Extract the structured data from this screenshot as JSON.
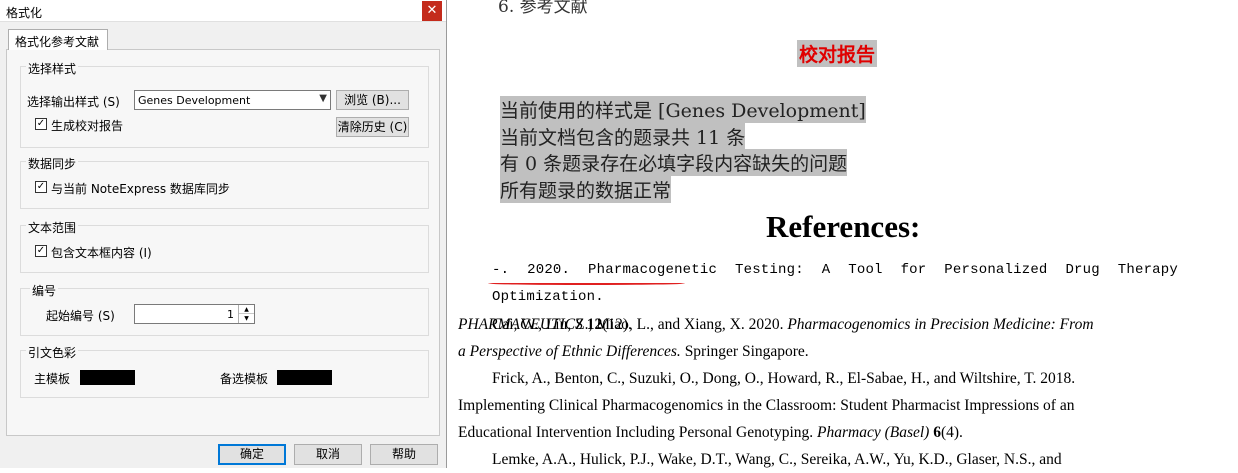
{
  "dialog": {
    "title": "格式化",
    "close_glyph": "✕",
    "tab_label": "格式化参考文献",
    "style_group": {
      "title": "选择样式",
      "output_style_label": "选择输出样式 (S)",
      "output_style_value": "Genes Development",
      "browse_button": "浏览 (B)...",
      "gen_report_label": "生成校对报告",
      "gen_report_checked": true,
      "clear_history_button": "清除历史 (C)"
    },
    "sync_group": {
      "title": "数据同步",
      "sync_label": "与当前 NoteExpress 数据库同步",
      "sync_checked": true
    },
    "text_range_group": {
      "title": "文本范围",
      "include_textbox_label": "包含文本框内容 (I)",
      "include_textbox_checked": true
    },
    "numbering_group": {
      "title": "编号",
      "start_number_label": "起始编号 (S)",
      "start_number_value": "1"
    },
    "color_group": {
      "title": "引文色彩",
      "main_template_label": "主模板",
      "alt_template_label": "备选模板",
      "main_template_color": "#000000",
      "alt_template_color": "#000000"
    },
    "buttons": {
      "ok": "确定",
      "cancel": "取消",
      "help": "帮助"
    }
  },
  "document": {
    "previous_heading": "6. 参考文献",
    "report_title": "校对报告",
    "report_lines": [
      "当前使用的样式是  [Genes Development]",
      "当前文档包含的题录共 11 条",
      "有 0 条题录存在必填字段内容缺失的问题",
      "所有题录的数据正常"
    ],
    "references_heading": "References:",
    "references": {
      "r1": {
        "l1": "-. 2020. Pharmacogenetic Testing: A Tool for Personalized Drug Therapy Optimization.",
        "l2_italic": "PHARMACEUTICS",
        "l2_bold": " 12",
        "l2_rest": "(12)."
      },
      "r2": {
        "l1_plain": "Cai, W., Liu, Z., Miao, L., and Xiang, X. 2020. ",
        "l1_italic": "Pharmacogenomics in Precision Medicine: From",
        "l2_italic": "a Perspective of Ethnic Differences.",
        "l2_rest": " Springer Singapore."
      },
      "r3": {
        "l1": "Frick, A., Benton, C., Suzuki, O., Dong, O., Howard, R., El-Sabae, H., and Wiltshire, T. 2018.",
        "l2": "Implementing Clinical Pharmacogenomics in the Classroom: Student Pharmacist Impressions of an",
        "l3_plain": "Educational Intervention Including Personal Genotyping. ",
        "l3_italic": "Pharmacy (Basel)",
        "l3_bold": " 6",
        "l3_rest": "(4)."
      },
      "r4": {
        "l1": "Lemke, A.A., Hulick, P.J., Wake, D.T., Wang, C., Sereika, A.W., Yu, K.D., Glaser, N.S., and"
      }
    }
  }
}
